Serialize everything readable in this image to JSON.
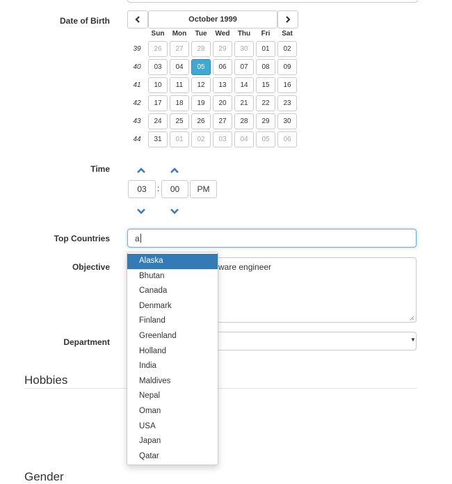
{
  "labels": {
    "dob": "Date of Birth",
    "time": "Time",
    "top_countries": "Top Countries",
    "objective": "Objective",
    "department": "Department"
  },
  "calendar": {
    "title": "October 1999",
    "prev_icon": "chevron-left-icon",
    "next_icon": "chevron-right-icon",
    "days_of_week": [
      "Sun",
      "Mon",
      "Tue",
      "Wed",
      "Thu",
      "Fri",
      "Sat"
    ],
    "weeks": [
      {
        "num": "39",
        "days": [
          {
            "d": "26",
            "muted": true
          },
          {
            "d": "27",
            "muted": true
          },
          {
            "d": "28",
            "muted": true
          },
          {
            "d": "29",
            "muted": true
          },
          {
            "d": "30",
            "muted": true
          },
          {
            "d": "01"
          },
          {
            "d": "02"
          }
        ]
      },
      {
        "num": "40",
        "days": [
          {
            "d": "03"
          },
          {
            "d": "04"
          },
          {
            "d": "05",
            "active": true
          },
          {
            "d": "06"
          },
          {
            "d": "07"
          },
          {
            "d": "08"
          },
          {
            "d": "09"
          }
        ]
      },
      {
        "num": "41",
        "days": [
          {
            "d": "10"
          },
          {
            "d": "11"
          },
          {
            "d": "12"
          },
          {
            "d": "13"
          },
          {
            "d": "14"
          },
          {
            "d": "15"
          },
          {
            "d": "16"
          }
        ]
      },
      {
        "num": "42",
        "days": [
          {
            "d": "17"
          },
          {
            "d": "18"
          },
          {
            "d": "19"
          },
          {
            "d": "20"
          },
          {
            "d": "21"
          },
          {
            "d": "22"
          },
          {
            "d": "23"
          }
        ]
      },
      {
        "num": "43",
        "days": [
          {
            "d": "24"
          },
          {
            "d": "25"
          },
          {
            "d": "26"
          },
          {
            "d": "27"
          },
          {
            "d": "28"
          },
          {
            "d": "29"
          },
          {
            "d": "30"
          }
        ]
      },
      {
        "num": "44",
        "days": [
          {
            "d": "31"
          },
          {
            "d": "01",
            "muted": true
          },
          {
            "d": "02",
            "muted": true
          },
          {
            "d": "03",
            "muted": true
          },
          {
            "d": "04",
            "muted": true
          },
          {
            "d": "05",
            "muted": true
          },
          {
            "d": "06",
            "muted": true
          }
        ]
      }
    ],
    "active_color": "#3fa9d6"
  },
  "time": {
    "hour": "03",
    "separator": ":",
    "minute": "00",
    "meridian": "PM",
    "up_icon": "chevron-up-icon",
    "down_icon": "chevron-down-icon"
  },
  "top_countries": {
    "value": "a",
    "suggestions": [
      "Alaska",
      "Bhutan",
      "Canada",
      "Denmark",
      "Finland",
      "Greenland",
      "Holland",
      "India",
      "Maldives",
      "Nepal",
      "Oman",
      "USA",
      "Japan",
      "Qatar"
    ],
    "active_index": 0
  },
  "objective": {
    "visible_text": "ware engineer"
  },
  "department": {
    "caret_icon": "caret-down-icon"
  },
  "sections": {
    "hobbies": "Hobbies",
    "gender": "Gender"
  },
  "colors": {
    "accent": "#337ab7",
    "focus": "#66afe9",
    "chevron": "#3a7bbf"
  }
}
